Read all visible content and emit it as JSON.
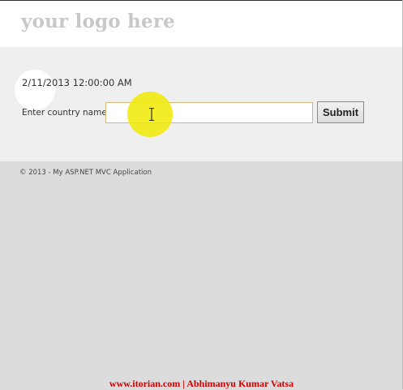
{
  "header": {
    "logo_text": "your logo here"
  },
  "main": {
    "date_text": "2/11/2013 12:00:00 AM",
    "country_label": "Enter country name",
    "country_input_value": "",
    "submit_label": "Submit"
  },
  "footer": {
    "copyright": "© 2013 - My ASP.NET MVC Application"
  },
  "watermark": {
    "site": "www.itorian.com",
    "separator": "|",
    "author": "Abhimanyu Kumar Vatsa"
  },
  "colors": {
    "cursor_highlight": "#f0eb0a",
    "watermark": "#cc0000",
    "logo": "#c8c8c8"
  },
  "icons": {
    "cursor": "ibeam-cursor-icon"
  }
}
